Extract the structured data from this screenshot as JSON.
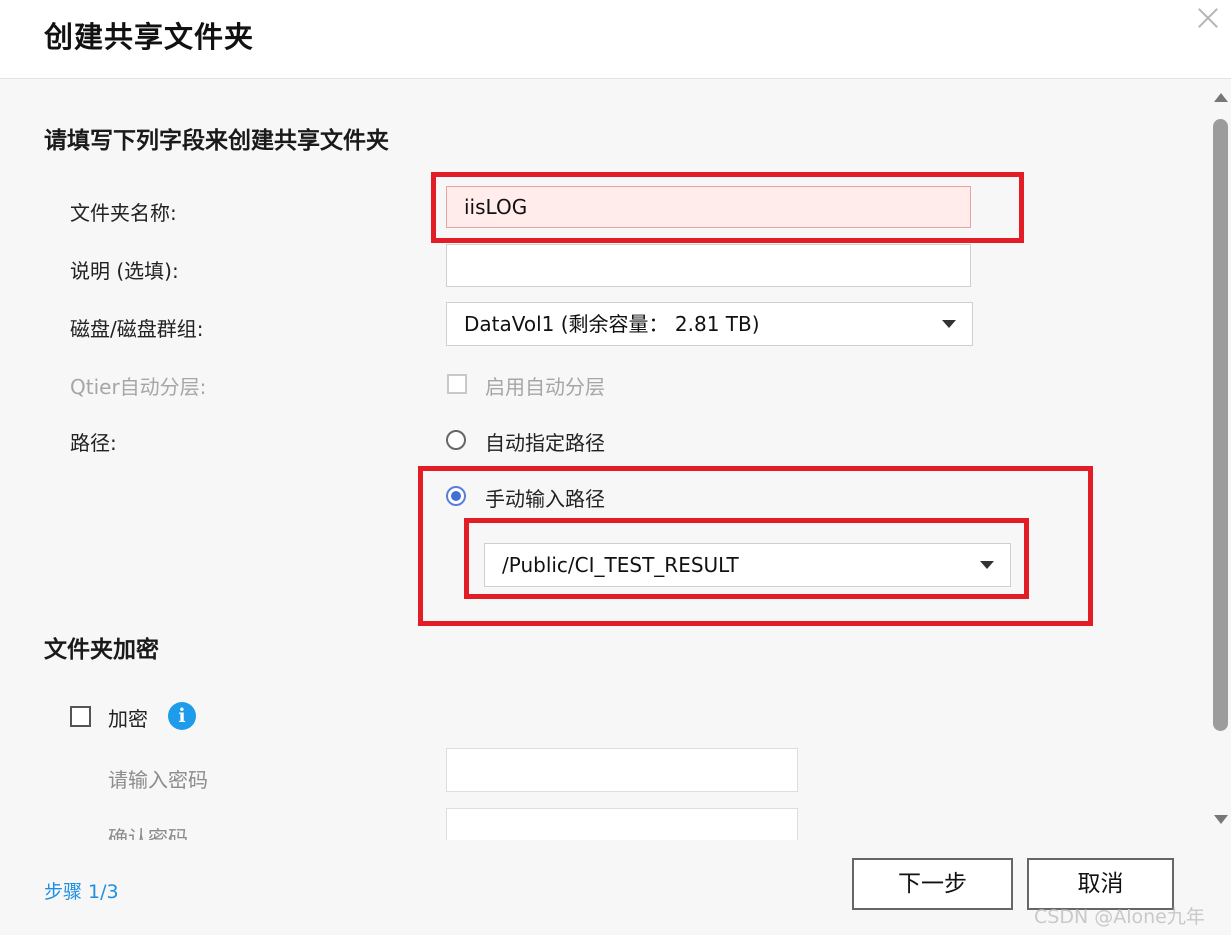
{
  "dialog": {
    "title": "创建共享文件夹"
  },
  "form": {
    "section_title": "请填写下列字段来创建共享文件夹",
    "folder_name": {
      "label": "文件夹名称:",
      "value": "iisLOG"
    },
    "description": {
      "label": "说明 (选填):",
      "value": ""
    },
    "volume": {
      "label": "磁盘/磁盘群组:",
      "selected": "DataVol1 (剩余容量： 2.81 TB)"
    },
    "qtier": {
      "label": "Qtier自动分层:",
      "checkbox_label": "启用自动分层",
      "checked": false,
      "disabled": true
    },
    "path": {
      "label": "路径:",
      "option_auto": "自动指定路径",
      "option_manual": "手动输入路径",
      "selected_option": "manual",
      "manual_value": "/Public/CI_TEST_RESULT"
    }
  },
  "encryption": {
    "section_title": "文件夹加密",
    "checkbox_label": "加密",
    "checked": false,
    "info_icon_glyph": "i",
    "password_label": "请输入密码",
    "confirm_label": "确认密码"
  },
  "footer": {
    "step": "步骤 1/3",
    "next_label": "下一步",
    "cancel_label": "取消",
    "watermark": "CSDN @Alone九年"
  },
  "colors": {
    "highlight_red": "#e31d26",
    "link_blue": "#1e8fe0",
    "info_blue": "#1e9bea",
    "radio_blue": "#3f6fd8",
    "error_bg": "#ffeceb"
  }
}
